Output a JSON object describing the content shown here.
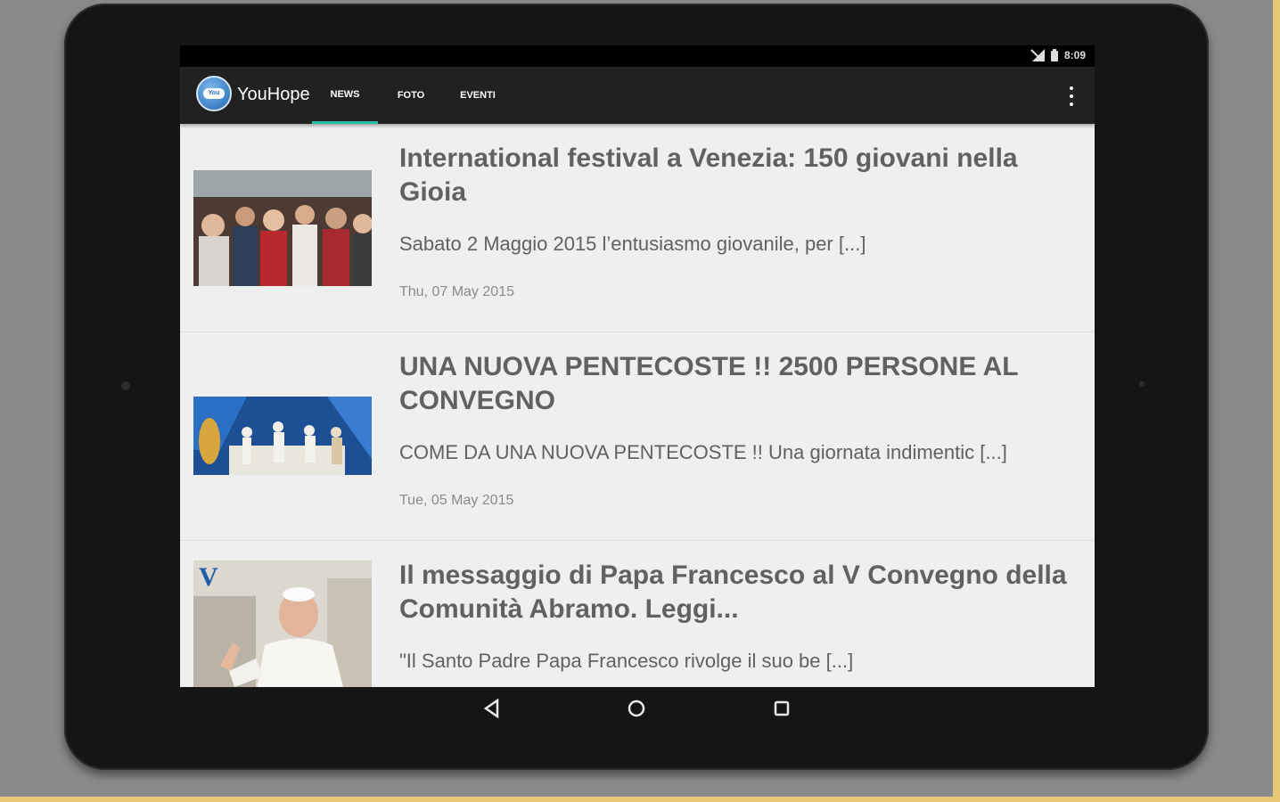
{
  "status_bar": {
    "time": "8:09"
  },
  "app_bar": {
    "title": "YouHope",
    "logo_text": "You",
    "tabs": [
      {
        "label": "NEWS",
        "active": true
      },
      {
        "label": "FOTO",
        "active": false
      },
      {
        "label": "EVENTI",
        "active": false
      }
    ],
    "overflow_icon": "more-vert-icon"
  },
  "news": [
    {
      "title": "International festival a Venezia: 150 giovani nella Gioia",
      "excerpt": "Sabato 2 Maggio 2015 l’entusiasmo giovanile, per  [...]",
      "date": "Thu, 07 May 2015",
      "image": "crowd-of-young-people-photo"
    },
    {
      "title": "UNA NUOVA PENTECOSTE !! 2500 PERSONE AL CONVEGNO",
      "excerpt": "COME DA UNA NUOVA PENTECOSTE !! Una giornata indimentic [...]",
      "date": "Tue, 05 May 2015",
      "image": "stage-celebration-photo"
    },
    {
      "title": "Il messaggio di Papa Francesco al V Convegno della Comunità Abramo. Leggi...",
      "excerpt": "\"Il Santo Padre Papa Francesco  rivolge il suo be [...]",
      "date": "",
      "image": "pope-francis-photo",
      "image_caption": "V"
    }
  ],
  "nav_bar": {
    "back": "back-icon",
    "home": "home-icon",
    "recents": "recents-icon"
  },
  "colors": {
    "accent": "#2bbba5",
    "app_bar": "#212121",
    "list_bg": "#efefef",
    "title_text": "#616161"
  }
}
